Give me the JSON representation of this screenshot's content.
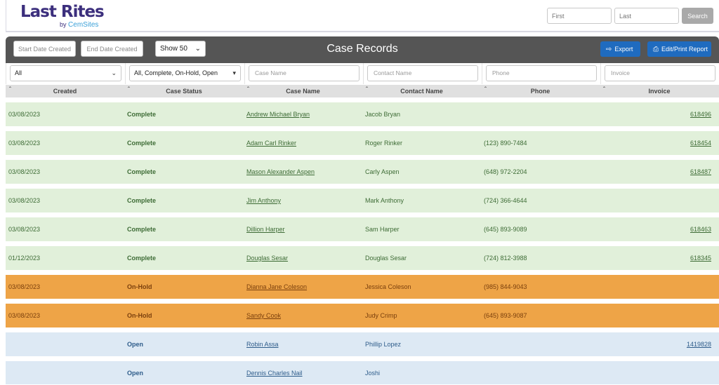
{
  "brand": {
    "name": "Last Rites",
    "by": "by",
    "company": "CemSites"
  },
  "search": {
    "first_placeholder": "First",
    "last_placeholder": "Last",
    "button": "Search"
  },
  "toolbar": {
    "start_date": "Start Date Created",
    "end_date": "End Date Created",
    "show": "Show 50",
    "title": "Case Records",
    "export": "Export",
    "print": "Edit/Print Report"
  },
  "filters": {
    "created": "All",
    "status": "All, Complete, On-Hold, Open",
    "case_name": "Case Name",
    "contact_name": "Contact Name",
    "phone": "Phone",
    "invoice": "Invoice"
  },
  "columns": [
    "Created",
    "Case Status",
    "Case Name",
    "Contact Name",
    "Phone",
    "Invoice"
  ],
  "colors": {
    "complete": "#e1f0da",
    "onhold": "#eea447",
    "open": "#dde9f4",
    "accent": "#1f6bbf",
    "toolbar": "#555555"
  },
  "rows": [
    {
      "created": "03/08/2023",
      "status": "Complete",
      "name": "Andrew Michael Bryan",
      "contact": "Jacob Bryan",
      "phone": "",
      "invoice": "618496"
    },
    {
      "created": "03/08/2023",
      "status": "Complete",
      "name": "Adam Carl Rinker",
      "contact": "Roger Rinker",
      "phone": "(123) 890-7484",
      "invoice": "618454"
    },
    {
      "created": "03/08/2023",
      "status": "Complete",
      "name": "Mason Alexander Aspen",
      "contact": "Carly Aspen",
      "phone": "(648) 972-2204",
      "invoice": "618487"
    },
    {
      "created": "03/08/2023",
      "status": "Complete",
      "name": "Jim Anthony",
      "contact": "Mark Anthony",
      "phone": "(724) 366-4644",
      "invoice": ""
    },
    {
      "created": "03/08/2023",
      "status": "Complete",
      "name": "Dillion Harper",
      "contact": "Sam Harper",
      "phone": "(645) 893-9089",
      "invoice": "618463"
    },
    {
      "created": "01/12/2023",
      "status": "Complete",
      "name": "Douglas Sesar",
      "contact": "Douglas Sesar",
      "phone": "(724) 812-3988",
      "invoice": "618345"
    },
    {
      "created": "03/08/2023",
      "status": "On-Hold",
      "name": "Dianna Jane Coleson",
      "contact": "Jessica Coleson",
      "phone": "(985) 844-9043",
      "invoice": ""
    },
    {
      "created": "03/08/2023",
      "status": "On-Hold",
      "name": "Sandy Cook",
      "contact": "Judy Crimp",
      "phone": "(645) 893-9087",
      "invoice": ""
    },
    {
      "created": "",
      "status": "Open",
      "name": "Robin Assa",
      "contact": "Phillip Lopez",
      "phone": "",
      "invoice": "1419828"
    },
    {
      "created": "",
      "status": "Open",
      "name": "Dennis Charles Nail",
      "contact": "Joshi",
      "phone": "",
      "invoice": ""
    }
  ]
}
